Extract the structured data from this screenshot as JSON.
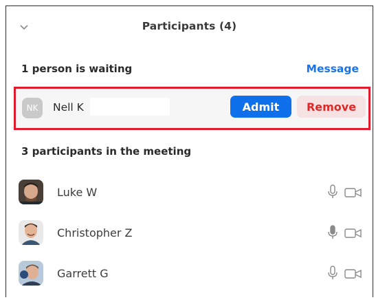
{
  "panel": {
    "title": "Participants (4)"
  },
  "waiting": {
    "label": "1 person is waiting",
    "message_link": "Message",
    "person": {
      "initials": "NK",
      "name": "Nell K",
      "admit_label": "Admit",
      "remove_label": "Remove"
    },
    "highlight_color": "#e01b2d"
  },
  "meeting": {
    "label": "3 participants in the meeting",
    "participants": [
      {
        "name": "Luke W",
        "avatar_icon": "person-photo-icon",
        "mic_icon": "microphone-icon",
        "cam_icon": "video-camera-icon"
      },
      {
        "name": "Christopher Z",
        "avatar_icon": "person-photo-icon",
        "mic_icon": "microphone-icon",
        "cam_icon": "video-camera-icon"
      },
      {
        "name": "Garrett G",
        "avatar_icon": "person-photo-icon",
        "mic_icon": "microphone-icon",
        "cam_icon": "video-camera-icon"
      }
    ]
  },
  "colors": {
    "admit": "#0e71eb",
    "remove_text": "#e02828",
    "remove_bg": "#f6e2e2",
    "link": "#1a73e8"
  }
}
